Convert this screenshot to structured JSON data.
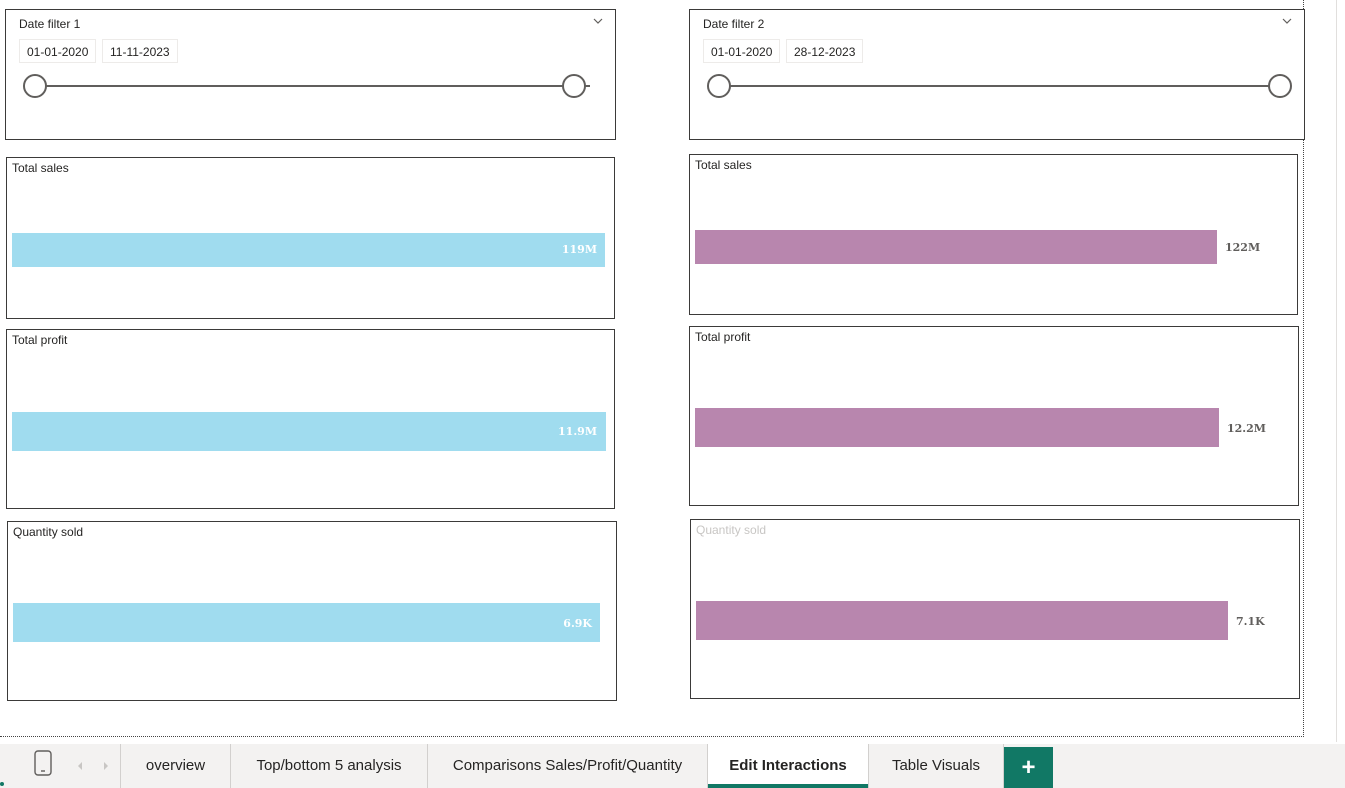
{
  "filters": {
    "left": {
      "title": "Date filter 1",
      "start": "01-01-2020",
      "end": "11-11-2023"
    },
    "right": {
      "title": "Date filter 2",
      "start": "01-01-2020",
      "end": "28-12-2023"
    }
  },
  "visuals": {
    "left": {
      "sales": {
        "title": "Total sales",
        "value_label": "119M",
        "value": 119
      },
      "profit": {
        "title": "Total profit",
        "value_label": "11.9M",
        "value": 11.9
      },
      "quantity": {
        "title": "Quantity sold",
        "value_label": "6.9K",
        "value": 6.9
      }
    },
    "right": {
      "sales": {
        "title": "Total sales",
        "value_label": "122M",
        "value": 122
      },
      "profit": {
        "title": "Total profit",
        "value_label": "12.2M",
        "value": 12.2
      },
      "quantity": {
        "title": "Quantity sold",
        "value_label": "7.1K",
        "value": 7.1
      }
    }
  },
  "colors": {
    "left_bar": "#a0dcef",
    "right_bar": "#b886ae",
    "accent": "#117865"
  },
  "tabs": [
    {
      "label": "overview",
      "active": false
    },
    {
      "label": "Top/bottom 5 analysis",
      "active": false
    },
    {
      "label": "Comparisons Sales/Profit/Quantity",
      "active": false
    },
    {
      "label": "Edit Interactions",
      "active": true
    },
    {
      "label": "Table Visuals",
      "active": false
    }
  ],
  "tabbar": {
    "add_label": "+",
    "phone_icon": "phone-icon",
    "prev_icon": "chevron-left-icon",
    "next_icon": "chevron-right-icon"
  }
}
